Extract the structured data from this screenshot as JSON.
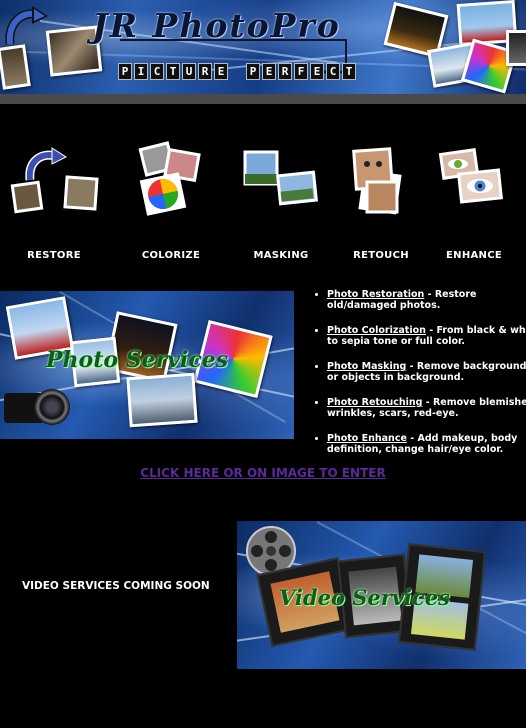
{
  "header": {
    "logo_title": "JR PhotoPro",
    "tagline": [
      "P",
      "I",
      "C",
      "T",
      "U",
      "R",
      "E",
      " ",
      "P",
      "E",
      "R",
      "F",
      "E",
      "C",
      "T"
    ]
  },
  "services_row": [
    {
      "label": "RESTORE",
      "icon": "restore-photos-icon"
    },
    {
      "label": "COLORIZE",
      "icon": "colorize-photos-icon"
    },
    {
      "label": "MASKING",
      "icon": "masking-photos-icon"
    },
    {
      "label": "RETOUCH",
      "icon": "retouch-photos-icon"
    },
    {
      "label": "ENHANCE",
      "icon": "enhance-eye-icon"
    }
  ],
  "photo_banner": {
    "title": "Photo Services"
  },
  "service_list": [
    {
      "link": "Photo Restoration",
      "desc": " - Restore old/damaged photos."
    },
    {
      "link": "Photo Colorization",
      "desc": " - From black & white to sepia tone or full color."
    },
    {
      "link": "Photo Masking",
      "desc": " - Remove background or objects in background."
    },
    {
      "link": "Photo Retouching",
      "desc": " - Remove blemishes, wrinkles, scars, red-eye."
    },
    {
      "link": "Photo Enhance",
      "desc": " - Add makeup, body definition, change hair/eye color."
    }
  ],
  "enter_link": "CLICK HERE OR ON IMAGE TO ENTER",
  "video": {
    "text": "VIDEO SERVICES COMING SOON",
    "banner_title": "Video Services"
  },
  "colors": {
    "background": "#000000",
    "header_blue": "#245ab0",
    "link_purple": "#5a2a9a",
    "banner_title_green": "#0b5e19"
  }
}
